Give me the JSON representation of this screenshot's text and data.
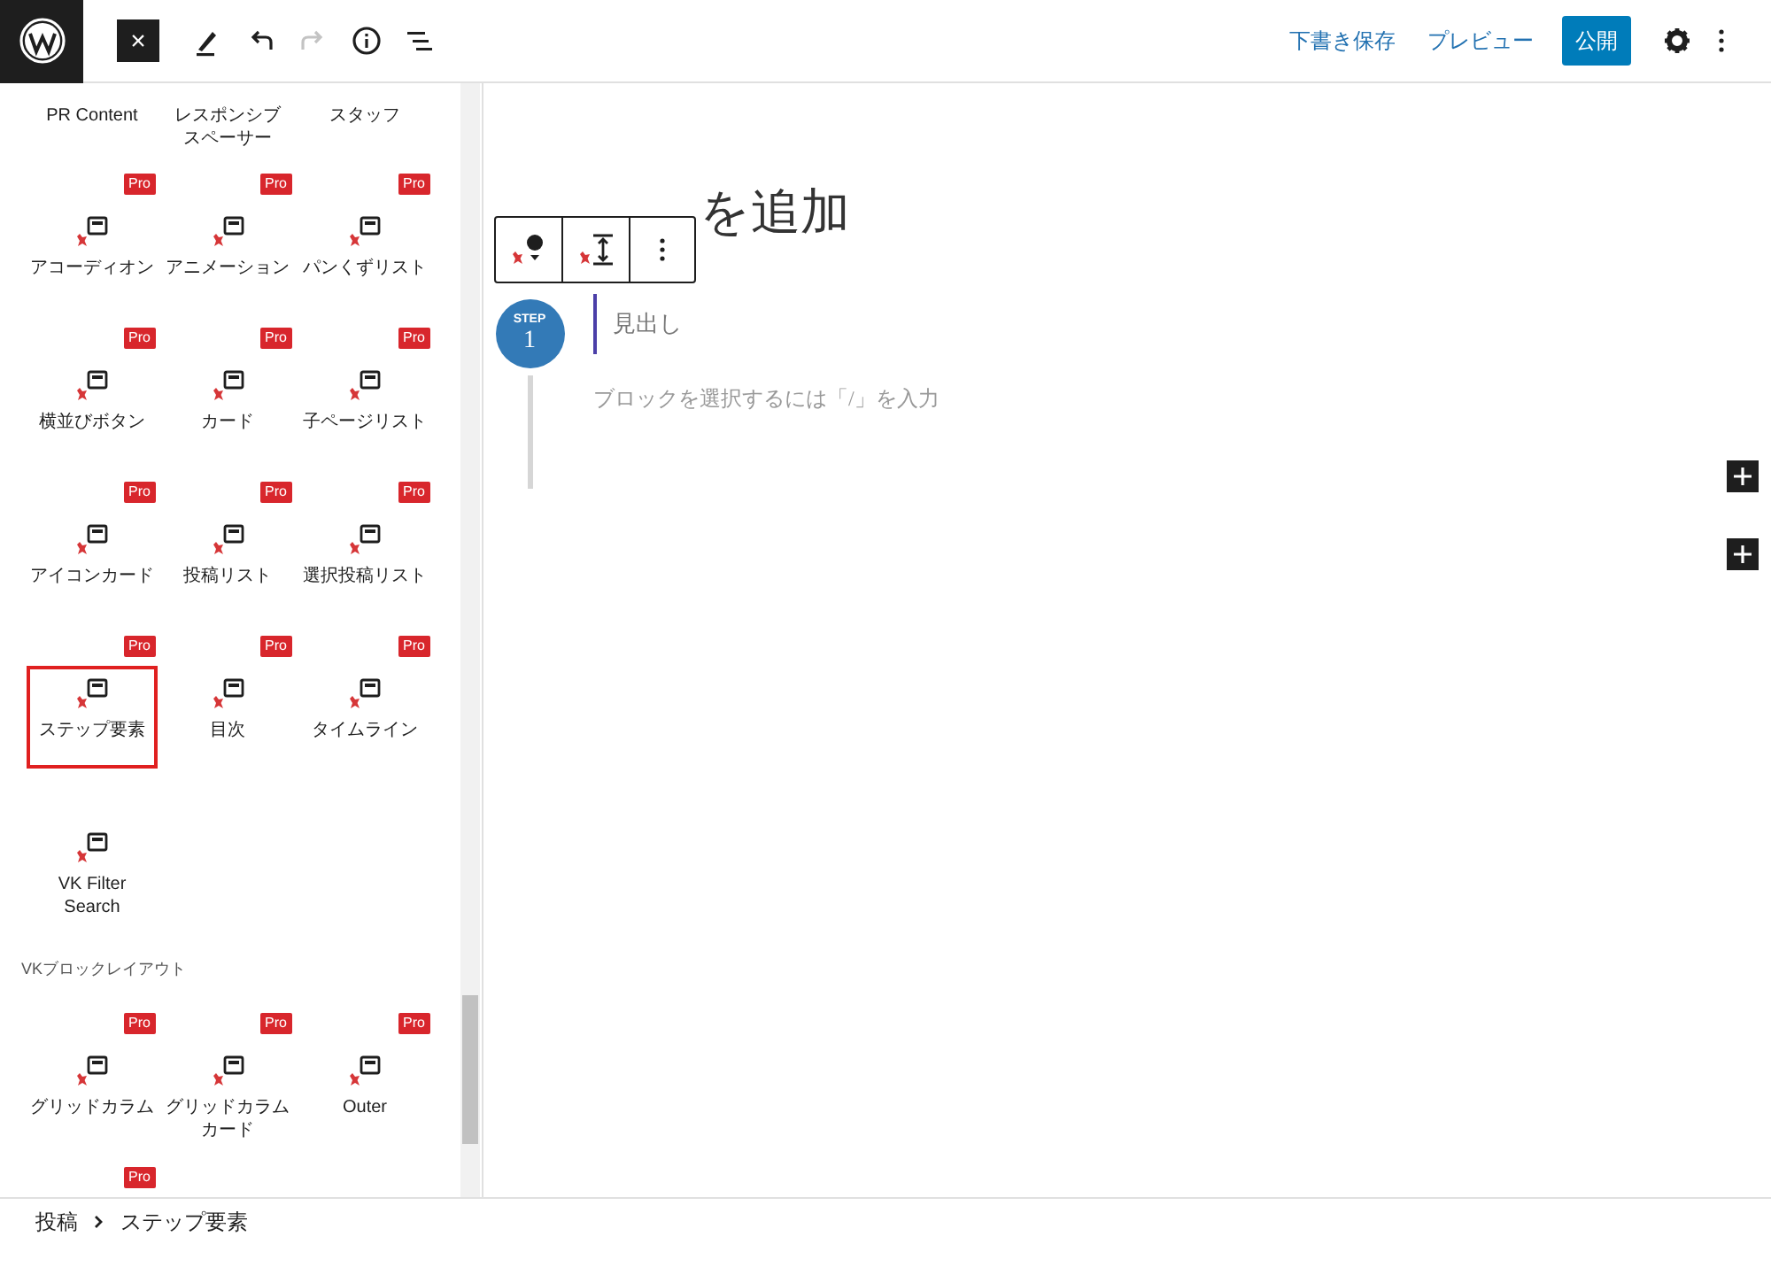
{
  "top_bar": {
    "close_symbol": "×",
    "save_draft": "下書き保存",
    "preview": "プレビュー",
    "publish": "公開",
    "redo_disabled": true
  },
  "inserter": {
    "top_row_labels": [
      "PR Content",
      "レスポンシブスペーサー",
      "スタッフ"
    ],
    "blocks": [
      {
        "label": "アコーディオン",
        "badge": "Pro",
        "selected": false
      },
      {
        "label": "アニメーション",
        "badge": "Pro",
        "selected": false
      },
      {
        "label": "パンくずリスト",
        "badge": "Pro",
        "selected": false
      },
      {
        "label": "横並びボタン",
        "badge": "Pro",
        "selected": false
      },
      {
        "label": "カード",
        "badge": "Pro",
        "selected": false
      },
      {
        "label": "子ページリスト",
        "badge": "Pro",
        "selected": false
      },
      {
        "label": "アイコンカード",
        "badge": "Pro",
        "selected": false
      },
      {
        "label": "投稿リスト",
        "badge": "Pro",
        "selected": false
      },
      {
        "label": "選択投稿リスト",
        "badge": "Pro",
        "selected": false
      },
      {
        "label": "ステップ要素",
        "badge": "Pro",
        "selected": true
      },
      {
        "label": "目次",
        "badge": "Pro",
        "selected": false
      },
      {
        "label": "タイムライン",
        "badge": "Pro",
        "selected": false
      },
      {
        "label": "VK Filter Search",
        "selected": false
      }
    ],
    "section_title": "VKブロックレイアウト",
    "layout_blocks": [
      {
        "label": "グリッドカラム",
        "badge": "Pro",
        "selected": false
      },
      {
        "label": "グリッドカラムカード",
        "badge": "Pro",
        "selected": false
      },
      {
        "label": "Outer",
        "badge": "Pro",
        "selected": false
      },
      {
        "badge": "Pro"
      }
    ]
  },
  "editor": {
    "title_placeholder": "を追加",
    "step_label": "STEP",
    "step_number": "1",
    "heading_placeholder": "見出し",
    "block_placeholder": "ブロックを選択するには「/」を入力"
  },
  "breadcrumb": [
    "投稿",
    "ステップ要素"
  ]
}
